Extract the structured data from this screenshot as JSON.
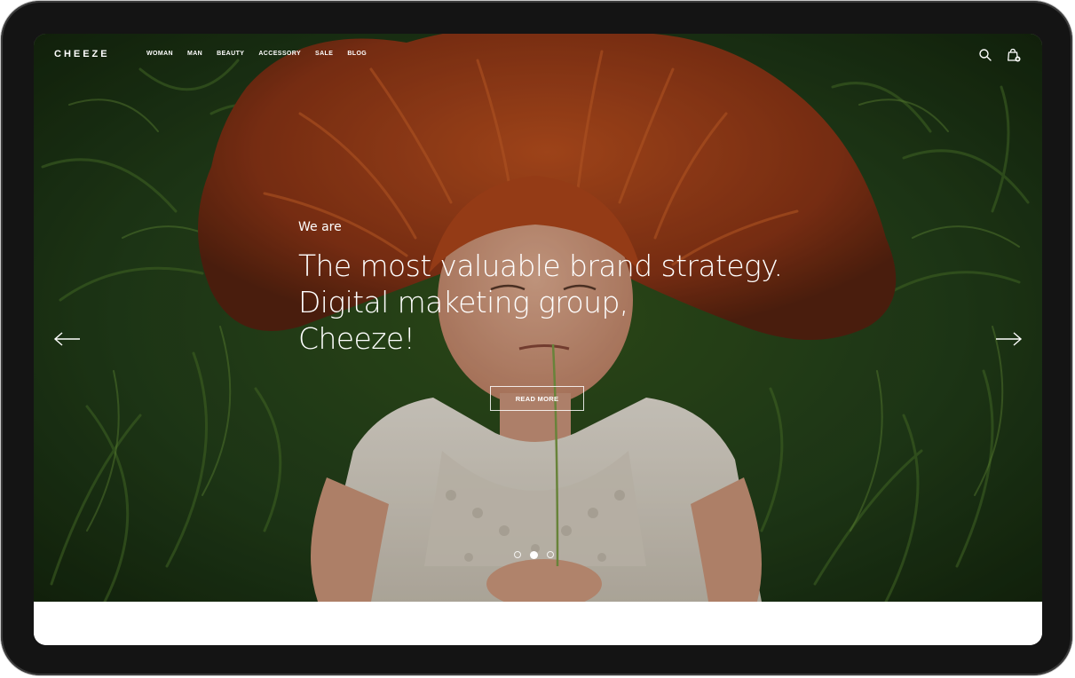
{
  "brand": {
    "logo": "CHEEZE"
  },
  "nav": {
    "items": [
      {
        "label": "WOMAN"
      },
      {
        "label": "MAN"
      },
      {
        "label": "BEAUTY"
      },
      {
        "label": "ACCESSORY"
      },
      {
        "label": "SALE"
      },
      {
        "label": "BLOG"
      }
    ]
  },
  "header_icons": {
    "search": "search-icon",
    "cart": "shopping-bag-icon"
  },
  "hero": {
    "eyebrow": "We are",
    "headline": [
      "The most valuable brand strategy.",
      "Digital maketing group,",
      "Cheeze!"
    ],
    "cta_label": "READ MORE",
    "prev_icon": "arrow-left-icon",
    "next_icon": "arrow-right-icon",
    "slides": {
      "count": 3,
      "active": 2
    }
  },
  "colors": {
    "device_frame": "#141414",
    "hair": "#a8431c",
    "grass": "#2c4a19",
    "text": "#ffffff"
  }
}
